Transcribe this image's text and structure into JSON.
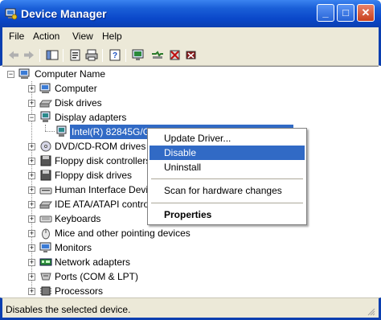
{
  "window": {
    "title": "Device Manager",
    "icon": "device-manager-icon"
  },
  "titlebar_buttons": {
    "minimize": "_",
    "maximize": "□",
    "close": "✕"
  },
  "menu": [
    "File",
    "Action",
    "View",
    "Help"
  ],
  "toolbar": {
    "buttons": [
      "back-icon",
      "forward-icon",
      "show-hide-tree-icon",
      "properties-icon",
      "print-icon",
      "help-icon",
      "update-driver-icon",
      "scan-hardware-icon",
      "uninstall-icon",
      "disable-icon"
    ]
  },
  "tree": {
    "root": "Computer Name",
    "items": [
      {
        "label": "Computer",
        "icon": "computer-icon",
        "expanded": false
      },
      {
        "label": "Disk drives",
        "icon": "disk-drive-icon",
        "expanded": false
      },
      {
        "label": "Display adapters",
        "icon": "display-adapter-icon",
        "expanded": true
      },
      {
        "label": "Intel(R) 82845G/GL/GE/PE/GV Graphics Controller",
        "icon": "display-adapter-icon",
        "child": true,
        "selected": true
      },
      {
        "label": "DVD/CD-ROM drives",
        "icon": "cdrom-icon",
        "expanded": false
      },
      {
        "label": "Floppy disk controllers",
        "icon": "floppy-controller-icon",
        "expanded": false
      },
      {
        "label": "Floppy disk drives",
        "icon": "floppy-drive-icon",
        "expanded": false
      },
      {
        "label": "Human Interface Devices",
        "icon": "hid-icon",
        "expanded": false
      },
      {
        "label": "IDE ATA/ATAPI controllers",
        "icon": "ide-controller-icon",
        "expanded": false
      },
      {
        "label": "Keyboards",
        "icon": "keyboard-icon",
        "expanded": false
      },
      {
        "label": "Mice and other pointing devices",
        "icon": "mouse-icon",
        "expanded": false
      },
      {
        "label": "Monitors",
        "icon": "monitor-icon",
        "expanded": false
      },
      {
        "label": "Network adapters",
        "icon": "network-adapter-icon",
        "expanded": false
      },
      {
        "label": "Ports (COM & LPT)",
        "icon": "port-icon",
        "expanded": false
      },
      {
        "label": "Processors",
        "icon": "processor-icon",
        "expanded": false
      }
    ]
  },
  "context_menu": {
    "items": [
      "Update Driver...",
      "Disable",
      "Uninstall",
      "Scan for hardware changes",
      "Properties"
    ],
    "highlighted": "Disable"
  },
  "status": {
    "text": "Disables the selected device."
  },
  "colors": {
    "selection": "#316ac5",
    "titlebar": "#0a47c9",
    "chrome": "#ece9d8"
  }
}
